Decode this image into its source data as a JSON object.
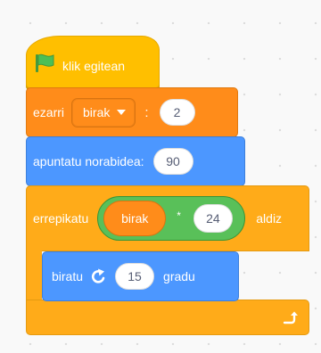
{
  "colors": {
    "events": "#ffbf00",
    "variables": "#ff8c1a",
    "motion": "#4c97ff",
    "control": "#ffab19",
    "operators": "#59c059",
    "flag": "#4cbf56",
    "canvas": "#f9f9f9"
  },
  "hat": {
    "icon": "green-flag-icon",
    "label": "klik egitean"
  },
  "set_var": {
    "label": "ezarri",
    "variable": "birak",
    "colon": ":",
    "value": "2"
  },
  "point_dir": {
    "label": "apuntatu norabidea:",
    "value": "90"
  },
  "repeat": {
    "label": "errepikatu",
    "suffix": "aldiz",
    "icon": "loop-arrow-icon",
    "multiply": {
      "left_var": "birak",
      "operator": "*",
      "right_value": "24"
    }
  },
  "turn": {
    "label": "biratu",
    "icon": "rotate-clockwise-icon",
    "value": "15",
    "unit": "gradu"
  }
}
